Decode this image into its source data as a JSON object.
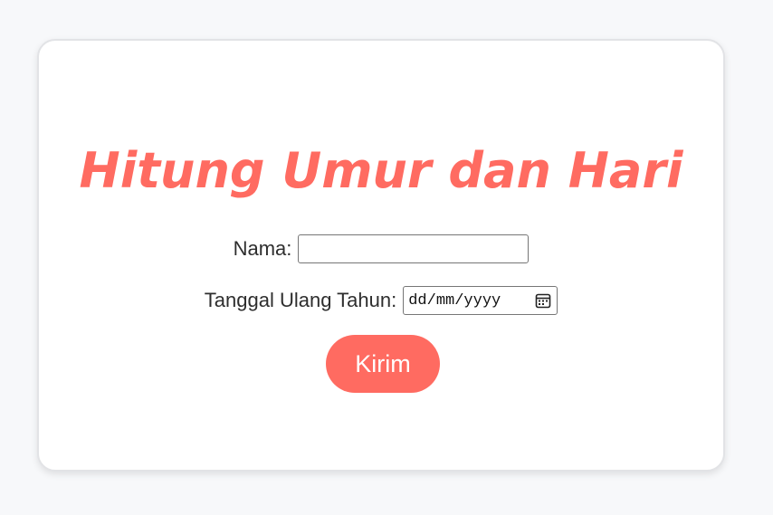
{
  "form": {
    "title": "Hitung Umur dan Hari",
    "name_label": "Nama:",
    "name_value": "",
    "birthday_label": "Tanggal Ulang Tahun:",
    "date_placeholder": "dd/mm/yyyy",
    "submit_label": "Kirim"
  },
  "colors": {
    "accent": "#ff6b61",
    "page_background": "#f7f8fa",
    "card_background": "#ffffff"
  },
  "icons": {
    "date_picker": "calendar-icon"
  }
}
